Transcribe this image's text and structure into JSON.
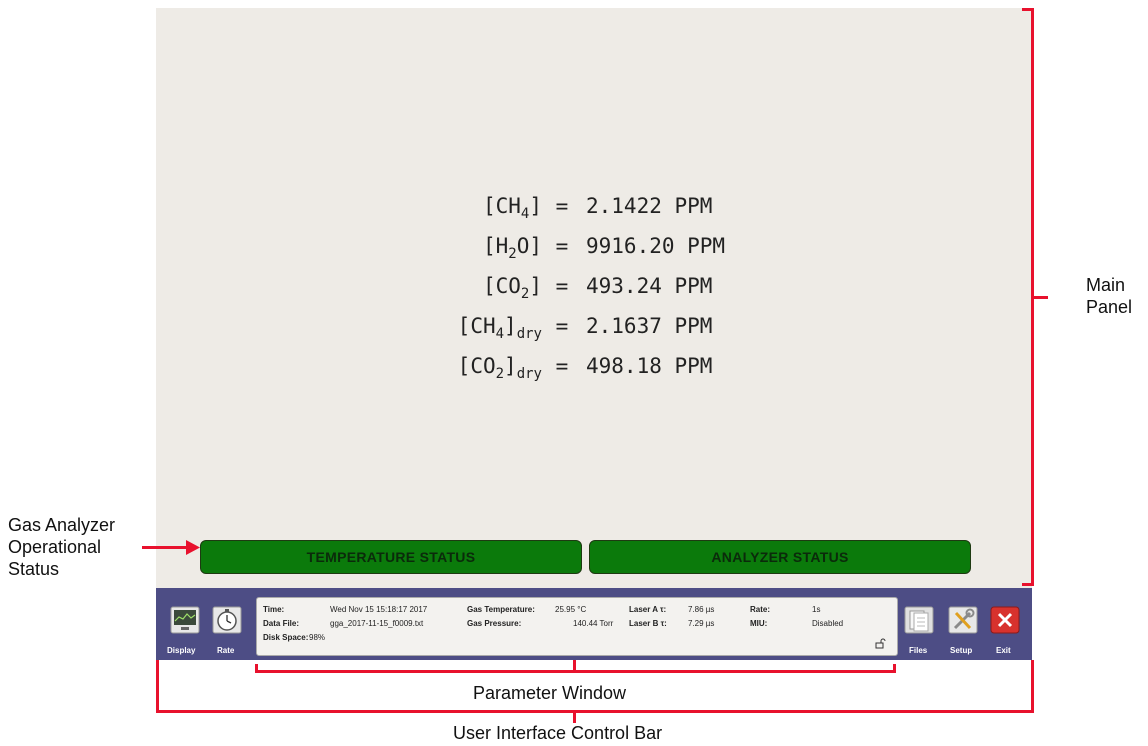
{
  "readings": [
    {
      "species": "CH",
      "sub": "4",
      "suffix": "",
      "value": "2.1422 PPM"
    },
    {
      "species": "H",
      "sub": "2",
      "tail": "O",
      "suffix": "",
      "value": "9916.20 PPM"
    },
    {
      "species": "CO",
      "sub": "2",
      "suffix": "",
      "value": "493.24 PPM"
    },
    {
      "species": "CH",
      "sub": "4",
      "suffix": "dry",
      "value": "2.1637 PPM"
    },
    {
      "species": "CO",
      "sub": "2",
      "suffix": "dry",
      "value": "498.18 PPM"
    }
  ],
  "status": {
    "temperature": "TEMPERATURE STATUS",
    "analyzer": "ANALYZER STATUS",
    "color": "#0b7a0b"
  },
  "toolbar": {
    "display": "Display",
    "rate": "Rate",
    "files": "Files",
    "setup": "Setup",
    "exit": "Exit"
  },
  "params": {
    "time_label": "Time:",
    "time_value": "Wed Nov 15 15:18:17 2017",
    "data_file_label": "Data File:",
    "data_file_value": "gga_2017-11-15_f0009.txt",
    "disk_label": "Disk Space:",
    "disk_value": "98%",
    "gas_temp_label": "Gas Temperature:",
    "gas_temp_value": "25.95 °C",
    "gas_pressure_label": "Gas Pressure:",
    "gas_pressure_value": "140.44 Torr",
    "laser_a_label": "Laser A τ:",
    "laser_a_value": "7.86 µs",
    "laser_b_label": "Laser B τ:",
    "laser_b_value": "7.29 µs",
    "rate_label": "Rate:",
    "rate_value": "1s",
    "miu_label": "MIU:",
    "miu_value": "Disabled"
  },
  "annotations": {
    "main_panel_1": "Main",
    "main_panel_2": "Panel",
    "gas_status_1": "Gas Analyzer",
    "gas_status_2": "Operational",
    "gas_status_3": "Status",
    "parameter_window": "Parameter Window",
    "control_bar": "User Interface Control Bar"
  },
  "colors": {
    "panel": "#eeebe6",
    "bar": "#4d4d85",
    "annotation": "#e8112d",
    "status_green": "#0b7a0b"
  }
}
